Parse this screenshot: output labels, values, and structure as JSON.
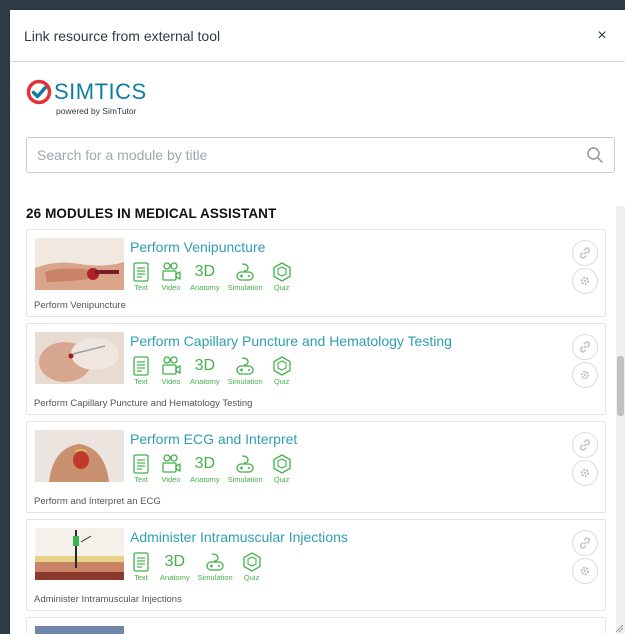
{
  "dialog": {
    "title": "Link resource from external tool",
    "close_label": "×"
  },
  "logo": {
    "word": "SIMTICS",
    "subtitle": "powered by SimTutor"
  },
  "search": {
    "placeholder": "Search for a module by title"
  },
  "list": {
    "heading": "26 MODULES IN MEDICAL ASSISTANT",
    "modules": [
      {
        "title": "Perform Venipuncture",
        "description": "Perform Venipuncture",
        "resources": [
          "Text",
          "Video",
          "Anatomy",
          "Simulation",
          "Quiz"
        ]
      },
      {
        "title": "Perform Capillary Puncture and Hematology Testing",
        "description": "Perform Capillary Puncture and Hematology Testing",
        "resources": [
          "Text",
          "Video",
          "Anatomy",
          "Simulation",
          "Quiz"
        ]
      },
      {
        "title": "Perform ECG and Interpret",
        "description": "Perform and Interpret an ECG",
        "resources": [
          "Text",
          "Video",
          "Anatomy",
          "Simulation",
          "Quiz"
        ]
      },
      {
        "title": "Administer Intramuscular Injections",
        "description": "Administer Intramuscular Injections",
        "resources": [
          "Text",
          "Anatomy",
          "Simulation",
          "Quiz"
        ]
      }
    ]
  },
  "icons": {
    "search": "search-icon",
    "link": "link-icon",
    "settings": "gear-icon",
    "logo": "check-circle-icon"
  },
  "colors": {
    "accent": "#2e9fb3",
    "resource_green": "#44b04b",
    "logo_red": "#e2333b",
    "logo_blue": "#0f7da2"
  }
}
